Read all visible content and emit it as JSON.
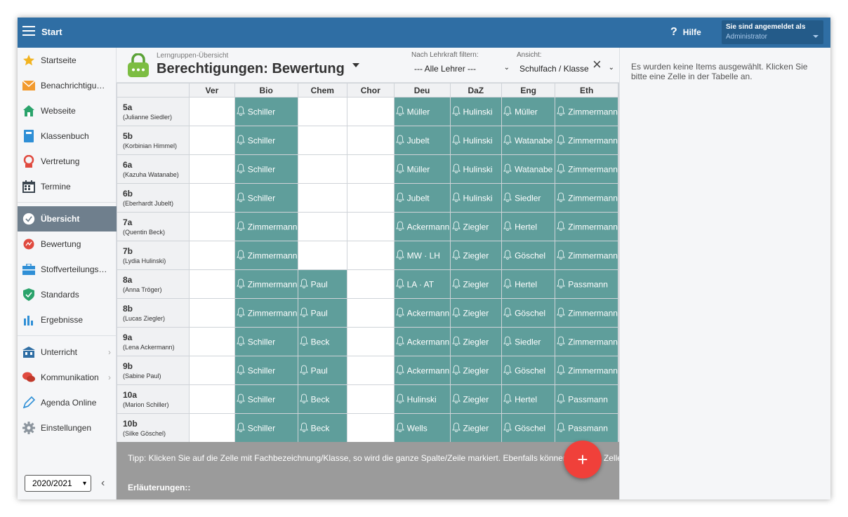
{
  "topbar": {
    "start_label": "Start",
    "help_label": "Hilfe",
    "user_line1": "Sie sind angemeldet als",
    "user_line2": "Administrator",
    "bg_color": "#2f6ea4"
  },
  "sidebar": {
    "items": [
      {
        "label": "Startseite",
        "icon": "star-icon"
      },
      {
        "label": "Benachrichtigungen",
        "icon": "envelope-icon"
      },
      {
        "label": "Webseite",
        "icon": "home-icon"
      },
      {
        "label": "Klassenbuch",
        "icon": "book-icon"
      },
      {
        "label": "Vertretung",
        "icon": "substitute-icon"
      },
      {
        "label": "Termine",
        "icon": "calendar-icon"
      },
      {
        "label": "Übersicht",
        "icon": "check-circle-icon",
        "active": true
      },
      {
        "label": "Bewertung",
        "icon": "rating-icon"
      },
      {
        "label": "Stoffverteilungsplan",
        "icon": "briefcase-icon"
      },
      {
        "label": "Standards",
        "icon": "shield-check-icon"
      },
      {
        "label": "Ergebnisse",
        "icon": "bar-chart-icon"
      },
      {
        "label": "Unterricht",
        "icon": "school-icon"
      },
      {
        "label": "Kommunikation",
        "icon": "chat-icon"
      },
      {
        "label": "Agenda Online",
        "icon": "pen-icon"
      },
      {
        "label": "Einstellungen",
        "icon": "gear-icon"
      }
    ],
    "school_year": "2020/2021"
  },
  "header": {
    "subtitle": "Lerngruppen-Übersicht",
    "title": "Berechtigungen: Bewertung",
    "filter_label": "Nach Lehrkraft filtern:",
    "filter_value": "--- Alle Lehrer ---",
    "view_label": "Ansicht:",
    "view_value": "Schulfach / Klasse"
  },
  "table": {
    "columns": [
      "Ver",
      "Bio",
      "Chem",
      "Chor",
      "Deu",
      "DaZ",
      "Eng",
      "Eth"
    ],
    "rows": [
      {
        "cls": "5a",
        "teacher": "(Julianne Siedler)",
        "cells": [
          "",
          "Schiller",
          "",
          "",
          "Müller",
          "Hulinski",
          "Müller",
          "Zimmermann"
        ]
      },
      {
        "cls": "5b",
        "teacher": "(Korbinian Himmel)",
        "cells": [
          "",
          "Schiller",
          "",
          "",
          "Jubelt",
          "Hulinski",
          "Watanabe",
          "Zimmermann"
        ]
      },
      {
        "cls": "6a",
        "teacher": "(Kazuha Watanabe)",
        "cells": [
          "",
          "Schiller",
          "",
          "",
          "Müller",
          "Hulinski",
          "Watanabe",
          "Zimmermann"
        ]
      },
      {
        "cls": "6b",
        "teacher": "(Eberhardt Jubelt)",
        "cells": [
          "",
          "Schiller",
          "",
          "",
          "Jubelt",
          "Hulinski",
          "Siedler",
          "Zimmermann"
        ]
      },
      {
        "cls": "7a",
        "teacher": "(Quentin Beck)",
        "cells": [
          "",
          "Zimmermann",
          "",
          "",
          "Ackermann",
          "Ziegler",
          "Hertel",
          "Zimmermann"
        ]
      },
      {
        "cls": "7b",
        "teacher": "(Lydia Hulinski)",
        "cells": [
          "",
          "Zimmermann",
          "",
          "",
          "MW · LH",
          "Ziegler",
          "Göschel",
          "Zimmermann"
        ]
      },
      {
        "cls": "8a",
        "teacher": "(Anna Tröger)",
        "cells": [
          "",
          "Zimmermann",
          "Paul",
          "",
          "LA · AT",
          "Ziegler",
          "Hertel",
          "Passmann"
        ]
      },
      {
        "cls": "8b",
        "teacher": "(Lucas Ziegler)",
        "cells": [
          "",
          "Zimmermann",
          "Paul",
          "",
          "Ackermann",
          "Ziegler",
          "Göschel",
          "Zimmermann"
        ]
      },
      {
        "cls": "9a",
        "teacher": "(Lena Ackermann)",
        "cells": [
          "",
          "Schiller",
          "Beck",
          "",
          "Ackermann",
          "Ziegler",
          "Siedler",
          "Zimmermann"
        ]
      },
      {
        "cls": "9b",
        "teacher": "(Sabine Paul)",
        "cells": [
          "",
          "Schiller",
          "Paul",
          "",
          "Ackermann",
          "Ziegler",
          "Göschel",
          "Zimmermann"
        ]
      },
      {
        "cls": "10a",
        "teacher": "(Marion Schiller)",
        "cells": [
          "",
          "Schiller",
          "Beck",
          "",
          "Hulinski",
          "Ziegler",
          "Hertel",
          "Passmann"
        ]
      },
      {
        "cls": "10b",
        "teacher": "(Silke Göschel)",
        "cells": [
          "",
          "Schiller",
          "Beck",
          "",
          "Wells",
          "Ziegler",
          "Göschel",
          "Passmann"
        ]
      }
    ],
    "filled_color": "#5f9e9b"
  },
  "footer": {
    "tip": "Tipp: Klicken Sie auf die Zelle mit Fachbezeichnung/Klasse, so wird die ganze Spalte/Zeile markiert. Ebenfalls können mehrere Zellen markiert werden.",
    "explanations": "Erläuterungen::"
  },
  "fab_label": "+",
  "right_panel": {
    "message": "Es wurden keine Items ausgewählt. Klicken Sie bitte eine Zelle in der Tabelle an."
  }
}
